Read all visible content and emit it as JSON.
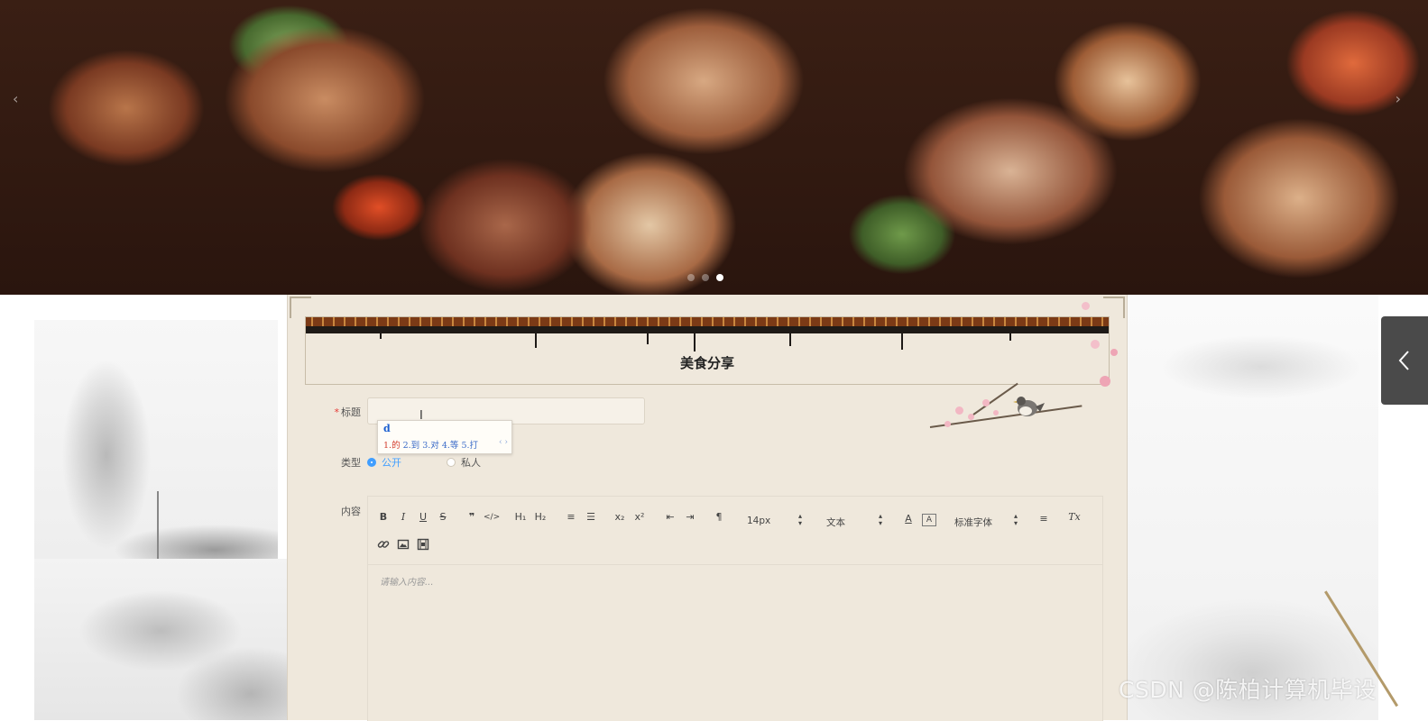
{
  "banner": {
    "prev_arrow": "‹",
    "next_arrow": "›",
    "slide_count": 3,
    "active_slide": 3
  },
  "drawer": {
    "toggle_icon": "chevron-left-icon"
  },
  "form": {
    "heading": "美食分享",
    "title_field": {
      "label": "标题",
      "required": true,
      "value": ""
    },
    "ime": {
      "composition": "d",
      "candidates": [
        "1.的",
        "2.到",
        "3.对",
        "4.等",
        "5.打"
      ],
      "nav": "‹ ›"
    },
    "type_field": {
      "label": "类型",
      "options": [
        "公开",
        "私人"
      ],
      "selected": "公开"
    },
    "content_field": {
      "label": "内容",
      "placeholder": "请输入内容...",
      "toolbar": {
        "bold": "B",
        "italic": "I",
        "underline": "U",
        "strike": "S",
        "quote": "❞",
        "code": "</>",
        "h1": "H₁",
        "h2": "H₂",
        "ordered_list": "≡",
        "bullet_list": "☰",
        "subscript": "x₂",
        "superscript": "x²",
        "outdent": "⇤",
        "indent": "⇥",
        "direction": "¶",
        "size_select": "14px",
        "header_select": "文本",
        "font_color": "A",
        "background_color": "A",
        "font_select": "标准字体",
        "align": "≡",
        "clean": "Tx",
        "link_icon": "link-icon",
        "image_icon": "image-icon",
        "video_icon": "video-icon"
      }
    }
  },
  "colors": {
    "accent": "#409eff",
    "required": "#e53935",
    "panel_bg": "#efe8dc",
    "drawer_bg": "#4a4a4a"
  },
  "watermark": "CSDN @陈柏计算机毕设"
}
